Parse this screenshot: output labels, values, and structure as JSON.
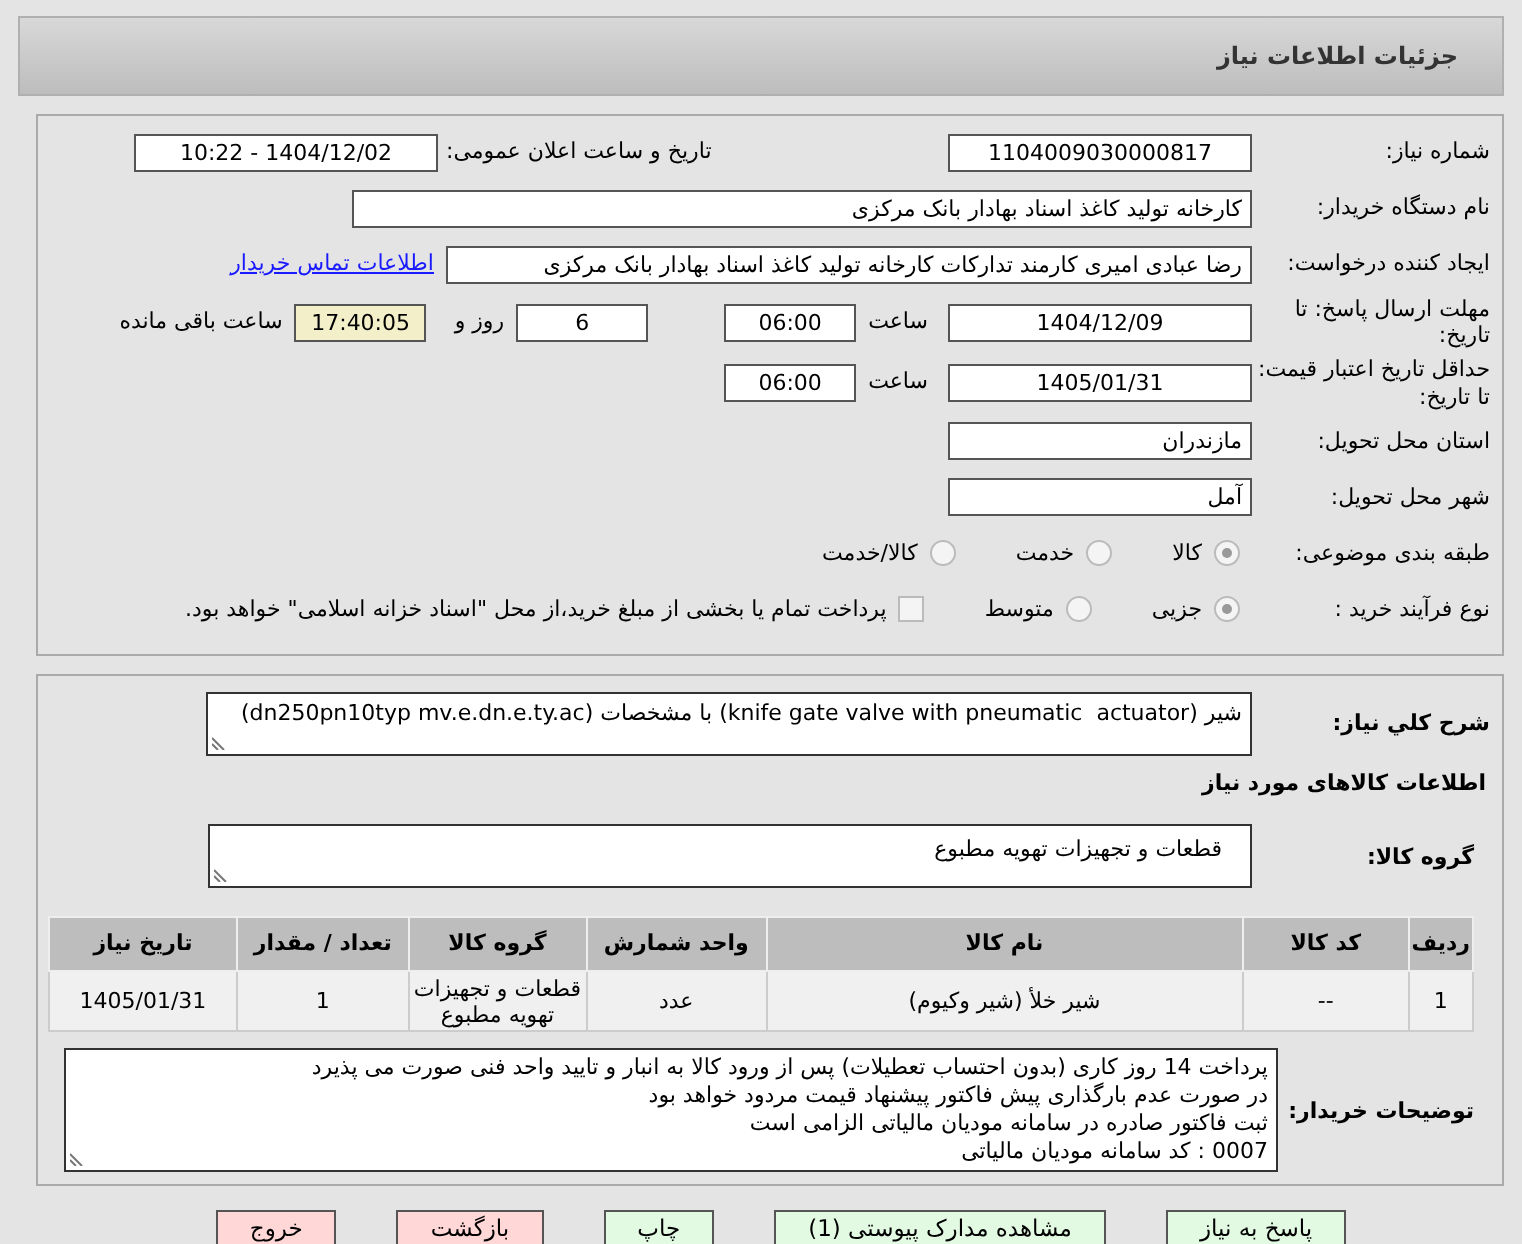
{
  "title": "جزئیات اطلاعات نیاز",
  "rows": [
    {
      "kind": "pair",
      "label": "شماره نیاز:",
      "value": "1104009030000817",
      "label2": "تاریخ و ساعت اعلان عمومی:",
      "value2": "1404/12/02 - 10:22"
    },
    {
      "kind": "wide",
      "label": "نام دستگاه خریدار:",
      "value": "کارخانه تولید کاغذ اسناد بهادار بانک مرکزی"
    },
    {
      "kind": "wide_link",
      "label": "ایجاد کننده درخواست:",
      "value": "رضا عبادی امیری کارمند تدارکات کارخانه تولید کاغذ اسناد بهادار بانک مرکزی",
      "link": "اطلاعات تماس خریدار"
    },
    {
      "kind": "deadline",
      "label": "مهلت ارسال پاسخ: تا تاریخ:",
      "date": "1404/12/09",
      "time_label": "ساعت",
      "time": "06:00",
      "days": "6",
      "days_label": "روز و",
      "remaining": "17:40:05",
      "remaining_label": "ساعت باقی مانده"
    },
    {
      "kind": "deadline",
      "label": "حداقل تاریخ اعتبار قیمت: تا تاریخ:",
      "date": "1405/01/31",
      "time_label": "ساعت",
      "time": "06:00"
    },
    {
      "kind": "short",
      "label": "استان محل تحویل:",
      "value": "مازندران"
    },
    {
      "kind": "short",
      "label": "شهر محل تحویل:",
      "value": "آمل"
    },
    {
      "kind": "options",
      "label": "طبقه بندی موضوعی:",
      "options": [
        {
          "label": "کالا",
          "selected": true
        },
        {
          "label": "خدمت",
          "selected": false
        },
        {
          "label": "کالا/خدمت",
          "selected": false
        }
      ]
    },
    {
      "kind": "options",
      "label": "نوع فرآیند خرید :",
      "options": [
        {
          "label": "جزیی",
          "selected": true
        },
        {
          "label": "متوسط",
          "selected": false
        }
      ],
      "checkbox": {
        "checked": false,
        "label": "پرداخت تمام یا بخشی از مبلغ خرید،از محل \"اسناد خزانه اسلامی\" خواهد بود."
      }
    }
  ],
  "description": {
    "label": "شرح کلي نياز:",
    "value": "شیر (knife gate valve with pneumatic  actuator) با مشخصات (dn250pn10typ mv.e.dn.e.ty.ac)"
  },
  "goods_heading": "اطلاعات کالاهای مورد نیاز",
  "group": {
    "label": "گروه کالا:",
    "value": "قطعات و تجهیزات تهویه مطبوع"
  },
  "table": {
    "columns": [
      "ردیف",
      "کد کالا",
      "نام کالا",
      "واحد شمارش",
      "گروه کالا",
      "تعداد / مقدار",
      "تاریخ نیاز"
    ],
    "rows": [
      [
        "1",
        "--",
        "شیر خلأ (شیر وکیوم)",
        "عدد",
        "قطعات و تجهیزات تهویه مطبوع",
        "1",
        "1405/01/31"
      ]
    ]
  },
  "notes": {
    "label": "توضیحات خریدار:",
    "lines": [
      "پرداخت 14 روز کاری (بدون احتساب تعطیلات) پس از ورود کالا به انبار و تایید واحد فنی صورت می پذیرد",
      "در صورت عدم بارگذاری پیش فاکتور پیشنهاد قیمت مردود خواهد بود",
      "ثبت فاکتور صادره در سامانه مودیان مالیاتی الزامی است",
      "0007 : کد سامانه مودیان مالیاتی"
    ]
  },
  "buttons": [
    {
      "label": "پاسخ به نیاز",
      "kind": "action"
    },
    {
      "label": "مشاهده مدارک پیوستی (1)",
      "kind": "action"
    },
    {
      "label": "چاپ",
      "kind": "action"
    },
    {
      "label": "بازگشت",
      "kind": "exit"
    },
    {
      "label": "خروج",
      "kind": "exit"
    }
  ]
}
